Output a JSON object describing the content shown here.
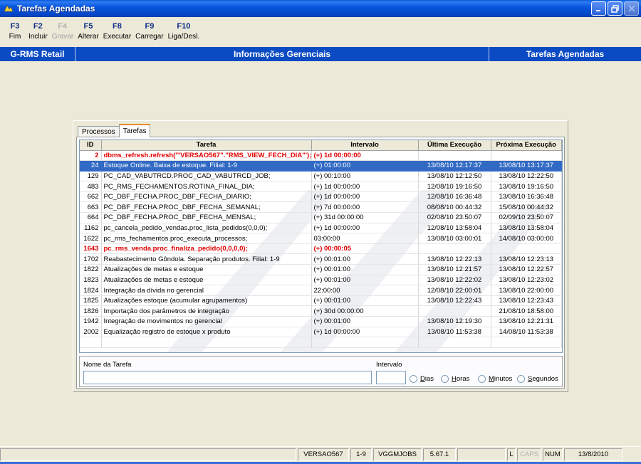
{
  "window": {
    "title": "Tarefas Agendadas"
  },
  "toolbar": [
    {
      "key": "F3",
      "label": "Fim",
      "enabled": true
    },
    {
      "key": "F2",
      "label": "Incluir",
      "enabled": true
    },
    {
      "key": "F4",
      "label": "Gravar",
      "enabled": false
    },
    {
      "key": "F5",
      "label": "Alterar",
      "enabled": true
    },
    {
      "key": "F8",
      "label": "Executar",
      "enabled": true
    },
    {
      "key": "F9",
      "label": "Carregar",
      "enabled": true
    },
    {
      "key": "F10",
      "label": "Liga/Desl.",
      "enabled": true
    }
  ],
  "header": {
    "left": "G-RMS Retail",
    "center": "Informações Gerenciais",
    "right": "Tarefas Agendadas"
  },
  "tabs": [
    "Processos",
    "Tarefas"
  ],
  "grid": {
    "columns": [
      "ID",
      "Tarefa",
      "Intervalo",
      "Última Execução",
      "Próxima Execução"
    ],
    "rows": [
      {
        "id": "2",
        "tarefa": "dbms_refresh.refresh('\"VERSAO567\".\"RMS_VIEW_FECH_DIA\"');",
        "intervalo": "(+) 1d 00:00:00",
        "ultima": "",
        "proxima": "",
        "state": "error"
      },
      {
        "id": "24",
        "tarefa": "Estoque Online. Baixa de estoque. Filial:  1-9",
        "intervalo": "(+) 01:00:00",
        "ultima": "13/08/10 12:17:37",
        "proxima": "13/08/10 13:17:37",
        "state": "selected"
      },
      {
        "id": "129",
        "tarefa": "PC_CAD_VABUTRCD.PROC_CAD_VABUTRCD_JOB;",
        "intervalo": "(+) 00:10:00",
        "ultima": "13/08/10 12:12:50",
        "proxima": "13/08/10 12:22:50",
        "state": ""
      },
      {
        "id": "483",
        "tarefa": "PC_RMS_FECHAMENTOS.ROTINA_FINAL_DIA;",
        "intervalo": "(+) 1d 00:00:00",
        "ultima": "12/08/10 19:16:50",
        "proxima": "13/08/10 19:16:50",
        "state": ""
      },
      {
        "id": "662",
        "tarefa": "PC_DBF_FECHA.PROC_DBF_FECHA_DIARIO;",
        "intervalo": "(+) 1d 00:00:00",
        "ultima": "12/08/10 16:36:48",
        "proxima": "13/08/10 16:36:48",
        "state": ""
      },
      {
        "id": "663",
        "tarefa": "PC_DBF_FECHA.PROC_DBF_FECHA_SEMANAL;",
        "intervalo": "(+) 7d 00:00:00",
        "ultima": "08/08/10 00:44:32",
        "proxima": "15/08/10 00:44:32",
        "state": ""
      },
      {
        "id": "664",
        "tarefa": "PC_DBF_FECHA.PROC_DBF_FECHA_MENSAL;",
        "intervalo": "(+) 31d 00:00:00",
        "ultima": "02/08/10 23:50:07",
        "proxima": "02/09/10 23:50:07",
        "state": ""
      },
      {
        "id": "1162",
        "tarefa": "pc_cancela_pedido_vendas.proc_lista_pedidos(0,0,0);",
        "intervalo": "(+) 1d 00:00:00",
        "ultima": "12/08/10 13:58:04",
        "proxima": "13/08/10 13:58:04",
        "state": ""
      },
      {
        "id": "1622",
        "tarefa": "pc_rms_fechamentos.proc_executa_processos;",
        "intervalo": "03:00:00",
        "ultima": "13/08/10 03:00:01",
        "proxima": "14/08/10 03:00:00",
        "state": ""
      },
      {
        "id": "1643",
        "tarefa": "pc_rms_venda.proc_finaliza_pedido(0,0,0,0);",
        "intervalo": "(+) 00:00:05",
        "ultima": "",
        "proxima": "",
        "state": "error"
      },
      {
        "id": "1702",
        "tarefa": "Reabastecimento Gôndola. Separação produtos. Filial:  1-9",
        "intervalo": "(+) 00:01:00",
        "ultima": "13/08/10 12:22:13",
        "proxima": "13/08/10 12:23:13",
        "state": ""
      },
      {
        "id": "1822",
        "tarefa": "Atualizações de metas e estoque",
        "intervalo": "(+) 00:01:00",
        "ultima": "13/08/10 12:21:57",
        "proxima": "13/08/10 12:22:57",
        "state": ""
      },
      {
        "id": "1823",
        "tarefa": "Atualizações de metas e estoque",
        "intervalo": "(+) 00:01:00",
        "ultima": "13/08/10 12:22:02",
        "proxima": "13/08/10 12:23:02",
        "state": ""
      },
      {
        "id": "1824",
        "tarefa": "Integração da dívida no gerencial",
        "intervalo": "22:00:00",
        "ultima": "12/08/10 22:00:01",
        "proxima": "13/08/10 22:00:00",
        "state": ""
      },
      {
        "id": "1825",
        "tarefa": "Atualizações estoque (acumular agrupamentos)",
        "intervalo": "(+) 00:01:00",
        "ultima": "13/08/10 12:22:43",
        "proxima": "13/08/10 12:23:43",
        "state": ""
      },
      {
        "id": "1826",
        "tarefa": "Importação dos parâmetros de integração",
        "intervalo": "(+) 30d 00:00:00",
        "ultima": "",
        "proxima": "21/08/10 18:58:00",
        "state": ""
      },
      {
        "id": "1942",
        "tarefa": "Integração de movimentos no gerencial",
        "intervalo": "(+) 00:01:00",
        "ultima": "13/08/10 12:19:30",
        "proxima": "13/08/10 12:21:31",
        "state": ""
      },
      {
        "id": "2002",
        "tarefa": "Equalização registro de estoque x produto",
        "intervalo": "(+) 1d 00:00:00",
        "ultima": "13/08/10 11:53:38",
        "proxima": "14/08/10 11:53:38",
        "state": ""
      }
    ]
  },
  "filter": {
    "nome_label": "Nome da Tarefa",
    "nome_value": "",
    "intervalo_label": "Intervalo",
    "intervalo_value": "",
    "units": [
      {
        "pre": "",
        "u": "D",
        "post": "ias"
      },
      {
        "pre": "",
        "u": "H",
        "post": "oras"
      },
      {
        "pre": "",
        "u": "M",
        "post": "inutos"
      },
      {
        "pre": "",
        "u": "S",
        "post": "egundos"
      }
    ]
  },
  "status": {
    "schema": "VERSAO567",
    "filial": "1-9",
    "job": "VGGMJOBS",
    "version": "5.67.1",
    "l": "L",
    "caps": "CAPS",
    "num": "NUM",
    "date": "13/8/2010"
  },
  "colors": {
    "titlebar": "#0855dd",
    "header": "#0a4bc4",
    "selected": "#316ac5",
    "error": "#e00000"
  }
}
